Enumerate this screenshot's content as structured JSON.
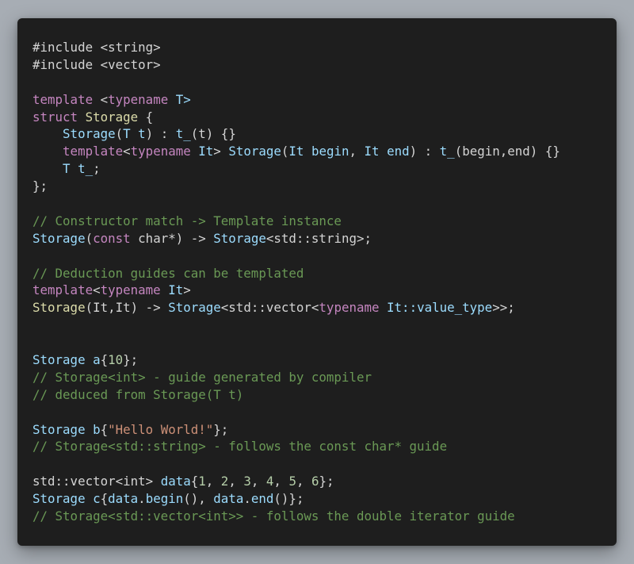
{
  "editor": {
    "background": "#1e1e1e",
    "page_background": "#a7adb4",
    "language": "C++"
  },
  "code_lines": [
    [
      {
        "t": "#include <string>",
        "c": "pre"
      }
    ],
    [
      {
        "t": "#include <vector>",
        "c": "pre"
      }
    ],
    [],
    [
      {
        "t": "template",
        "c": "kw"
      },
      {
        "t": " <",
        "c": "plain"
      },
      {
        "t": "typename",
        "c": "kw"
      },
      {
        "t": " T>",
        "c": "id"
      }
    ],
    [
      {
        "t": "struct",
        "c": "kw"
      },
      {
        "t": " ",
        "c": "plain"
      },
      {
        "t": "Storage",
        "c": "cls"
      },
      {
        "t": " {",
        "c": "plain"
      }
    ],
    [
      {
        "t": "    Storage",
        "c": "id"
      },
      {
        "t": "(",
        "c": "plain"
      },
      {
        "t": "T t",
        "c": "id"
      },
      {
        "t": ") : ",
        "c": "plain"
      },
      {
        "t": "t_",
        "c": "id"
      },
      {
        "t": "(t) {}",
        "c": "plain"
      }
    ],
    [
      {
        "t": "    template",
        "c": "kw"
      },
      {
        "t": "<",
        "c": "plain"
      },
      {
        "t": "typename",
        "c": "kw"
      },
      {
        "t": " It",
        "c": "id"
      },
      {
        "t": "> ",
        "c": "plain"
      },
      {
        "t": "Storage",
        "c": "id"
      },
      {
        "t": "(",
        "c": "plain"
      },
      {
        "t": "It begin",
        "c": "id"
      },
      {
        "t": ", ",
        "c": "plain"
      },
      {
        "t": "It end",
        "c": "id"
      },
      {
        "t": ") : ",
        "c": "plain"
      },
      {
        "t": "t_",
        "c": "id"
      },
      {
        "t": "(begin,end) {}",
        "c": "plain"
      }
    ],
    [
      {
        "t": "    T t_",
        "c": "id"
      },
      {
        "t": ";",
        "c": "plain"
      }
    ],
    [
      {
        "t": "};",
        "c": "plain"
      }
    ],
    [],
    [
      {
        "t": "// Constructor match -> Template instance",
        "c": "cm"
      }
    ],
    [
      {
        "t": "Storage",
        "c": "id"
      },
      {
        "t": "(",
        "c": "plain"
      },
      {
        "t": "const",
        "c": "kw"
      },
      {
        "t": " char*) -> ",
        "c": "plain"
      },
      {
        "t": "Storage",
        "c": "id"
      },
      {
        "t": "<std::string>;",
        "c": "plain"
      }
    ],
    [],
    [
      {
        "t": "// Deduction guides can be templated",
        "c": "cm"
      }
    ],
    [
      {
        "t": "template",
        "c": "kw"
      },
      {
        "t": "<",
        "c": "plain"
      },
      {
        "t": "typename",
        "c": "kw"
      },
      {
        "t": " It",
        "c": "id"
      },
      {
        "t": ">",
        "c": "plain"
      }
    ],
    [
      {
        "t": "Storage",
        "c": "cls"
      },
      {
        "t": "(It,It) -> ",
        "c": "plain"
      },
      {
        "t": "Storage",
        "c": "id"
      },
      {
        "t": "<std::vector<",
        "c": "plain"
      },
      {
        "t": "typename",
        "c": "kw"
      },
      {
        "t": " ",
        "c": "plain"
      },
      {
        "t": "It::value_type",
        "c": "id"
      },
      {
        "t": ">>;",
        "c": "plain"
      }
    ],
    [],
    [],
    [
      {
        "t": "Storage",
        "c": "id"
      },
      {
        "t": " ",
        "c": "plain"
      },
      {
        "t": "a",
        "c": "id"
      },
      {
        "t": "{",
        "c": "plain"
      },
      {
        "t": "10",
        "c": "num"
      },
      {
        "t": "};",
        "c": "plain"
      }
    ],
    [
      {
        "t": "// Storage<int> - guide generated by compiler",
        "c": "cm"
      }
    ],
    [
      {
        "t": "// deduced from Storage(T t)",
        "c": "cm"
      }
    ],
    [],
    [
      {
        "t": "Storage",
        "c": "id"
      },
      {
        "t": " ",
        "c": "plain"
      },
      {
        "t": "b",
        "c": "id"
      },
      {
        "t": "{",
        "c": "plain"
      },
      {
        "t": "\"Hello World!\"",
        "c": "str"
      },
      {
        "t": "};",
        "c": "plain"
      }
    ],
    [
      {
        "t": "// Storage<std::string> - follows the const char* guide",
        "c": "cm"
      }
    ],
    [],
    [
      {
        "t": "std::vector<int> ",
        "c": "plain"
      },
      {
        "t": "data",
        "c": "id"
      },
      {
        "t": "{",
        "c": "plain"
      },
      {
        "t": "1",
        "c": "num"
      },
      {
        "t": ", ",
        "c": "plain"
      },
      {
        "t": "2",
        "c": "num"
      },
      {
        "t": ", ",
        "c": "plain"
      },
      {
        "t": "3",
        "c": "num"
      },
      {
        "t": ", ",
        "c": "plain"
      },
      {
        "t": "4",
        "c": "num"
      },
      {
        "t": ", ",
        "c": "plain"
      },
      {
        "t": "5",
        "c": "num"
      },
      {
        "t": ", ",
        "c": "plain"
      },
      {
        "t": "6",
        "c": "num"
      },
      {
        "t": "};",
        "c": "plain"
      }
    ],
    [
      {
        "t": "Storage",
        "c": "id"
      },
      {
        "t": " ",
        "c": "plain"
      },
      {
        "t": "c",
        "c": "id"
      },
      {
        "t": "{",
        "c": "plain"
      },
      {
        "t": "data",
        "c": "id"
      },
      {
        "t": ".",
        "c": "plain"
      },
      {
        "t": "begin",
        "c": "id"
      },
      {
        "t": "(), ",
        "c": "plain"
      },
      {
        "t": "data",
        "c": "id"
      },
      {
        "t": ".",
        "c": "plain"
      },
      {
        "t": "end",
        "c": "id"
      },
      {
        "t": "()};",
        "c": "plain"
      }
    ],
    [
      {
        "t": "// Storage<std::vector<int>> - follows the double iterator guide",
        "c": "cm"
      }
    ]
  ]
}
